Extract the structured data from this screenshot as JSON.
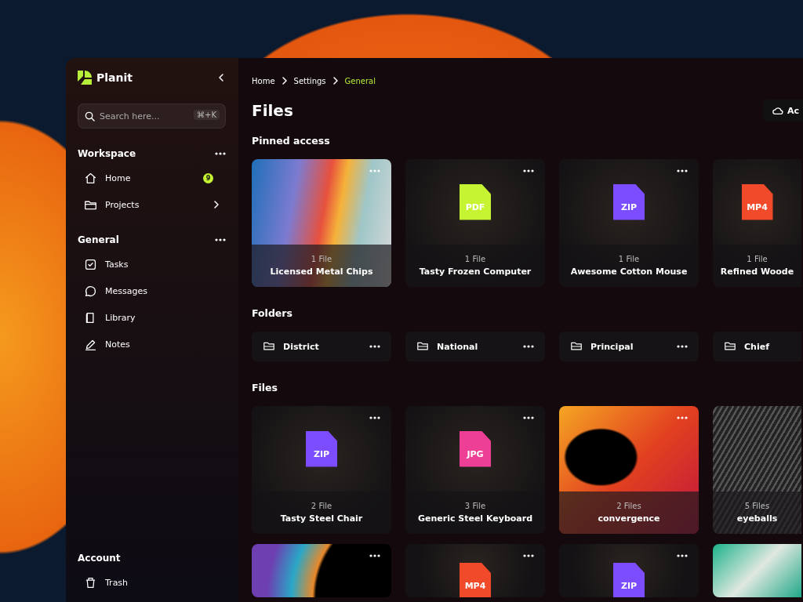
{
  "app": {
    "name": "Planit"
  },
  "search": {
    "placeholder": "Search here...",
    "shortcut": "⌘+K"
  },
  "sidebar": {
    "sections": [
      {
        "title": "Workspace",
        "items": [
          {
            "label": "Home",
            "badge": "9",
            "submenu": false
          },
          {
            "label": "Projects",
            "submenu": true
          }
        ]
      },
      {
        "title": "General",
        "items": [
          {
            "label": "Tasks",
            "submenu": false
          },
          {
            "label": "Messages",
            "submenu": false
          },
          {
            "label": "Library",
            "submenu": false
          },
          {
            "label": "Notes",
            "submenu": false
          }
        ]
      }
    ],
    "account": {
      "title": "Account",
      "items": [
        {
          "label": "Trash",
          "submenu": false
        }
      ]
    }
  },
  "breadcrumb": [
    {
      "label": "Home",
      "selected": false
    },
    {
      "label": "Settings",
      "selected": false
    },
    {
      "label": "General",
      "selected": true
    }
  ],
  "page_title": "Files",
  "action_button": "Ac",
  "pinned": {
    "title": "Pinned access",
    "items": [
      {
        "kind": "image",
        "count": "1 File",
        "name": "Licensed Metal Chips",
        "menu": true
      },
      {
        "kind": "file",
        "type": "PDF",
        "color": "#c6f432",
        "count": "1 File",
        "name": "Tasty Frozen Computer",
        "menu": true
      },
      {
        "kind": "file",
        "type": "ZIP",
        "color": "#7c4dff",
        "count": "1 File",
        "name": "Awesome Cotton Mouse",
        "menu": true
      },
      {
        "kind": "file",
        "type": "MP4",
        "color": "#f04a2a",
        "count": "1 File",
        "name": "Refined Woode",
        "menu": false
      }
    ]
  },
  "folders": {
    "title": "Folders",
    "items": [
      {
        "name": "District",
        "menu": true
      },
      {
        "name": "National",
        "menu": true
      },
      {
        "name": "Principal",
        "menu": true
      },
      {
        "name": "Chief",
        "menu": false
      }
    ]
  },
  "files": {
    "title": "Files",
    "items": [
      {
        "kind": "file",
        "type": "ZIP",
        "color": "#7c4dff",
        "count": "2 File",
        "name": "Tasty Steel Chair",
        "menu": true
      },
      {
        "kind": "file",
        "type": "JPG",
        "color": "#ec3f95",
        "count": "3 File",
        "name": "Generic Steel Keyboard",
        "menu": true
      },
      {
        "kind": "image",
        "count": "2 Files",
        "name": "convergence",
        "menu": true
      },
      {
        "kind": "image",
        "count": "5 Files",
        "name": "eyeballs",
        "menu": false
      },
      {
        "kind": "image",
        "menu": true
      },
      {
        "kind": "file",
        "type": "MP4",
        "color": "#f04a2a",
        "menu": true
      },
      {
        "kind": "file",
        "type": "ZIP",
        "color": "#7c4dff",
        "menu": true
      },
      {
        "kind": "image",
        "menu": false
      }
    ]
  }
}
